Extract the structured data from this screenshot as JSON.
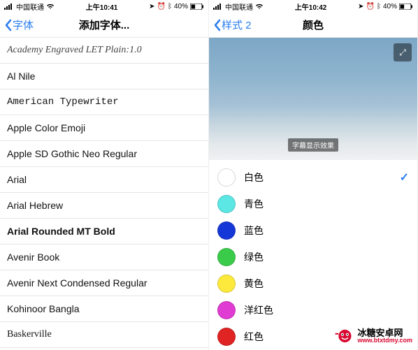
{
  "left": {
    "status": {
      "carrier": "中国联通",
      "time": "上午10:41",
      "battery": "40%"
    },
    "nav": {
      "back": "字体",
      "title": "添加字体..."
    },
    "fonts": [
      "Academy Engraved LET Plain:1.0",
      "Al Nile",
      "American Typewriter",
      "Apple Color Emoji",
      "Apple SD Gothic Neo Regular",
      "Arial",
      "Arial Hebrew",
      "Arial Rounded MT Bold",
      "Avenir Book",
      "Avenir Next Condensed Regular",
      "Kohinoor Bangla",
      "Baskerville"
    ]
  },
  "right": {
    "status": {
      "carrier": "中国联通",
      "time": "上午10:42",
      "battery": "40%"
    },
    "nav": {
      "back": "样式 2",
      "title": "颜色"
    },
    "subtitle_sample": "字幕显示效果",
    "colors": [
      {
        "name": "白色",
        "hex": "#ffffff",
        "selected": true
      },
      {
        "name": "青色",
        "hex": "#5de7e4"
      },
      {
        "name": "蓝色",
        "hex": "#1637d8"
      },
      {
        "name": "绿色",
        "hex": "#3bcb4a"
      },
      {
        "name": "黄色",
        "hex": "#fde93c"
      },
      {
        "name": "洋红色",
        "hex": "#e03bd2"
      },
      {
        "name": "红色",
        "hex": "#e02323"
      }
    ]
  },
  "watermark": {
    "name": "冰糖安卓网",
    "url": "www.btxtdmy.com"
  },
  "icons": {
    "expand": "⤢",
    "check": "✓"
  }
}
